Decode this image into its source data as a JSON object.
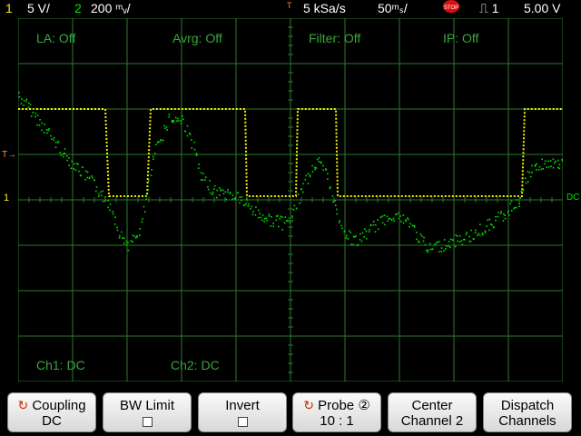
{
  "status_bar": {
    "ch1_number": "1",
    "ch1_scale": "5 V/",
    "ch2_number": "2",
    "ch2_scale": "200 ᵐᵥ/",
    "trigger_marker": "T",
    "sample_rate": "5 kSa/s",
    "timebase": "50ᵐₛ/",
    "run_state": "STOP",
    "trigger_mode": "⎍ 1",
    "trigger_level": "5.00  V"
  },
  "annotations": {
    "la": "LA: Off",
    "avrg": "Avrg: Off",
    "filter": "Filter: Off",
    "ip": "IP: Off",
    "ch1_coupling": "Ch1: DC",
    "ch2_coupling": "Ch2: DC"
  },
  "markers": {
    "trigger_level_marker": "T→",
    "ch1_ground_marker": "1",
    "dc_marker": "DC"
  },
  "colors": {
    "ch1": "#f0f000",
    "ch2": "#00e000",
    "grid": "#2c7a2c",
    "annotation": "#38a838"
  },
  "softkeys": [
    {
      "line1": "Coupling",
      "line2": "DC",
      "icon": "rotary-arrow-icon"
    },
    {
      "line1": "BW Limit",
      "line2": "",
      "icon": "checkbox"
    },
    {
      "line1": "Invert",
      "line2": "",
      "icon": "checkbox"
    },
    {
      "line1": "Probe ②",
      "line2": "10 : 1",
      "icon": "rotary-arrow-icon"
    },
    {
      "line1": "Center",
      "line2": "Channel 2"
    },
    {
      "line1": "Dispatch",
      "line2": "Channels"
    }
  ]
}
